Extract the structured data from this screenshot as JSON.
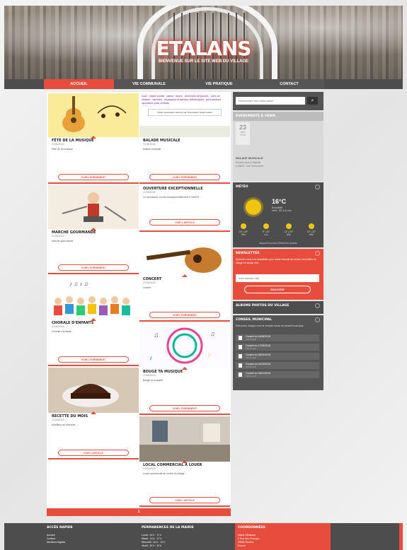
{
  "site": {
    "title": "ETALANS",
    "subtitle": "BIENVENUE SUR LE SITE WEB DU VILLAGE"
  },
  "nav": {
    "items": [
      "ACCUEIL",
      "VIE COMMUNALE",
      "VIE PRATIQUE",
      "CONTACT"
    ]
  },
  "cards": [
    {
      "title": "FÊTE DE LA MUSIQUE",
      "date": "21/06/2018",
      "text": "Fête de la musique",
      "button": "VOIR L'ÉVÉNEMENT"
    },
    {
      "title": "BALADE MUSICALE",
      "date": "23/06/2018",
      "text": "balade musicale",
      "button": "VOIR L'ÉVÉNEMENT",
      "poster_text": "rock · chant choral · piano · blues · orchestre de jeunes · cors de chasse · variétés · musiques et danses folkloriques · percussions · spectacle pour enfants",
      "poster_sub": "Petite restauration assurée par l'Association Quartmusical"
    },
    {
      "title": "OUVERTURE EXCEPTIONNELLE",
      "date": "21/06/2018",
      "text": "Le secrétariat ouvrira exceptionnellement à TAVER",
      "button": "VOIR L'ARTICLE"
    },
    {
      "title": "MARCHE GOURMANDE",
      "date": "21/06/2018",
      "text": "marche gourmande",
      "button": "VOIR L'ÉVÉNEMENT"
    },
    {
      "title": "CONCERT",
      "date": "21/06/2018",
      "text": "concert",
      "button": "VOIR L'ÉVÉNEMENT"
    },
    {
      "title": "CHORALE D'ENFANTS",
      "date": "21/06/2018",
      "text": "Chorale d'enfants",
      "button": "VOIR L'ÉVÉNEMENT"
    },
    {
      "title": "BOUGE TA MUSIQUE",
      "date": "21/06/2018",
      "text": "Bouge ta musique",
      "button": "VOIR L'ÉVÉNEMENT"
    },
    {
      "title": "RECETTE DU MOIS",
      "date": "21/06/2018",
      "text": "Moelleux au chocolat",
      "button": "VOIR L'ARTICLE"
    },
    {
      "title": "LOCAL COMMERCIAL À LOUER",
      "date": "21/06/2018",
      "text": "Local commercial au centre du village",
      "button": "VOIR L'ARTICLE"
    }
  ],
  "pager": {
    "current": "1"
  },
  "sidebar": {
    "search_placeholder": "Rechercher une information",
    "events_title": "ÉVÉNEMENTS À VENIR",
    "event": {
      "day": "23",
      "month": "JUIN",
      "year": "2018",
      "title": "BALADE MUSICALE",
      "place": "Rendez-vous la Mavelle",
      "time": "à 18h00 · Voir l'événement"
    },
    "weather_title": "MÉTÉO",
    "weather": {
      "temp": "16°C",
      "desc": "Ensoleillé",
      "wind": "Vent : SE à 11 km",
      "forecast": [
        {
          "t": "18° | 28°",
          "d": "Dim"
        },
        {
          "t": "9° | 20°",
          "d": "Lun"
        },
        {
          "t": "11° | 20°",
          "d": "Mar"
        },
        {
          "t": "12° | 22°",
          "d": "Mer"
        }
      ],
      "footer": "Aujourd'hui nous fêtons les Audrey"
    },
    "newsletter_title": "NEWSLETTER",
    "newsletter_text": "Abonnez-vous à la newsletter pour rester informé de toutes l'actualités du village en temps réel.",
    "newsletter_placeholder": "Votre adresse mail",
    "newsletter_button": "ENVOYER",
    "albums_title": "ALBUMS PHOTOS DU VILLAGE",
    "conseil_title": "CONSEIL MUNICIPAL",
    "conseil_text": "Retrouvez chaque mois le compte rendu du conseil municipal.",
    "docs": [
      {
        "t": "Conseil du 14/06/2018",
        "s": "125 Ko pdf"
      },
      {
        "t": "Conseil du 17/05/2018",
        "s": "115 Ko pdf"
      },
      {
        "t": "Conseil du 06/04/2018",
        "s": "113 Ko pdf"
      },
      {
        "t": "Conseil du 01/03/2018",
        "s": "143 Ko pdf"
      },
      {
        "t": "Conseil du 18/01/2018",
        "s": "136 Ko pdf"
      }
    ]
  },
  "footer": {
    "col1_title": "ACCÈS RAPIDE",
    "col1": [
      "Accueil",
      "Contact",
      "Mentions légales"
    ],
    "col2_title": "PERMANENCES DE LA MAIRIE",
    "col2": [
      "Lundi : 14 h · 17 h",
      "Mardi : 14 h · 17 h",
      "Mercredi : 10 h · 12 h",
      "Jeudi : 10 h · 12 h"
    ],
    "col3_title": "COORDONNÉES",
    "col3": [
      "Mairie d'Etalans",
      "2 Rue des Granges",
      "25580 Étalans",
      "France"
    ]
  }
}
